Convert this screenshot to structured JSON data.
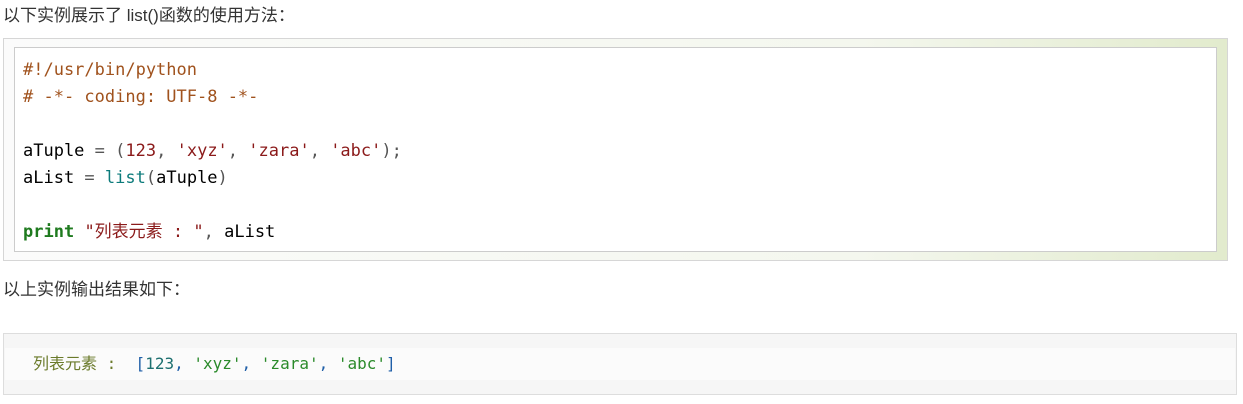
{
  "intro_text": "以下实例展示了 list()函数的使用方法：",
  "code": {
    "language": "python",
    "lines": [
      [
        {
          "t": "#!/usr/bin/python",
          "c": "comment"
        }
      ],
      [
        {
          "t": "# -*- coding: UTF-8 -*-",
          "c": "comment"
        }
      ],
      [],
      [
        {
          "t": "aTuple ",
          "c": "plain"
        },
        {
          "t": "=",
          "c": "op"
        },
        {
          "t": " ",
          "c": "plain"
        },
        {
          "t": "(",
          "c": "op"
        },
        {
          "t": "123",
          "c": "num"
        },
        {
          "t": ", ",
          "c": "op"
        },
        {
          "t": "'xyz'",
          "c": "str"
        },
        {
          "t": ", ",
          "c": "op"
        },
        {
          "t": "'zara'",
          "c": "str"
        },
        {
          "t": ", ",
          "c": "op"
        },
        {
          "t": "'abc'",
          "c": "str"
        },
        {
          "t": ");",
          "c": "op"
        }
      ],
      [
        {
          "t": "aList ",
          "c": "plain"
        },
        {
          "t": "=",
          "c": "op"
        },
        {
          "t": " ",
          "c": "plain"
        },
        {
          "t": "list",
          "c": "func"
        },
        {
          "t": "(",
          "c": "op"
        },
        {
          "t": "aTuple",
          "c": "plain"
        },
        {
          "t": ")",
          "c": "op"
        }
      ],
      [],
      [
        {
          "t": "print",
          "c": "kw"
        },
        {
          "t": " ",
          "c": "plain"
        },
        {
          "t": "\"列表元素 : \"",
          "c": "str"
        },
        {
          "t": ", ",
          "c": "op"
        },
        {
          "t": "aList",
          "c": "plain"
        }
      ]
    ]
  },
  "result_intro_text": "以上实例输出结果如下：",
  "output": {
    "line": [
      {
        "t": "列表元素 :  ",
        "c": "out-str"
      },
      {
        "t": "[",
        "c": "out-punc"
      },
      {
        "t": "123",
        "c": "out-num"
      },
      {
        "t": ", ",
        "c": "out-punc"
      },
      {
        "t": "'xyz'",
        "c": "out-q"
      },
      {
        "t": ", ",
        "c": "out-punc"
      },
      {
        "t": "'zara'",
        "c": "out-q"
      },
      {
        "t": ", ",
        "c": "out-punc"
      },
      {
        "t": "'abc'",
        "c": "out-q"
      },
      {
        "t": "]",
        "c": "out-punc"
      }
    ]
  }
}
